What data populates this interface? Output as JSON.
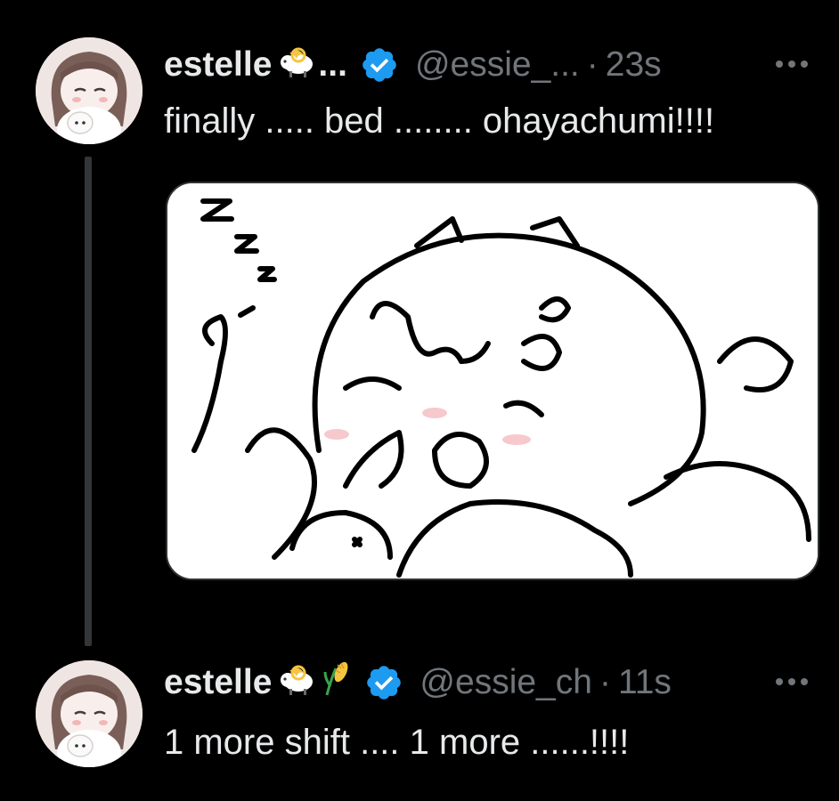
{
  "tweets": [
    {
      "author": {
        "display_name": "estelle",
        "name_truncation": "...",
        "emojis": [
          "ram-emoji"
        ],
        "verified": true,
        "handle": "@essie_...",
        "separator": "·",
        "time": "23s"
      },
      "text": "finally ..... bed ........ ohayachumi!!!!",
      "has_media": true
    },
    {
      "author": {
        "display_name": "estelle",
        "emojis": [
          "ram-emoji",
          "corn-emoji"
        ],
        "verified": true,
        "handle": "@essie_ch",
        "separator": "·",
        "time": "11s"
      },
      "text": "1 more shift .... 1 more ......!!!!",
      "has_media": false
    }
  ],
  "colors": {
    "background": "#000000",
    "primary_text": "#e7e9ea",
    "secondary_text": "#71767b",
    "verified_blue": "#1d9bf0",
    "thread_line": "#333639"
  },
  "icons": {
    "verified": "verified-badge-icon",
    "more": "more-options-icon"
  }
}
